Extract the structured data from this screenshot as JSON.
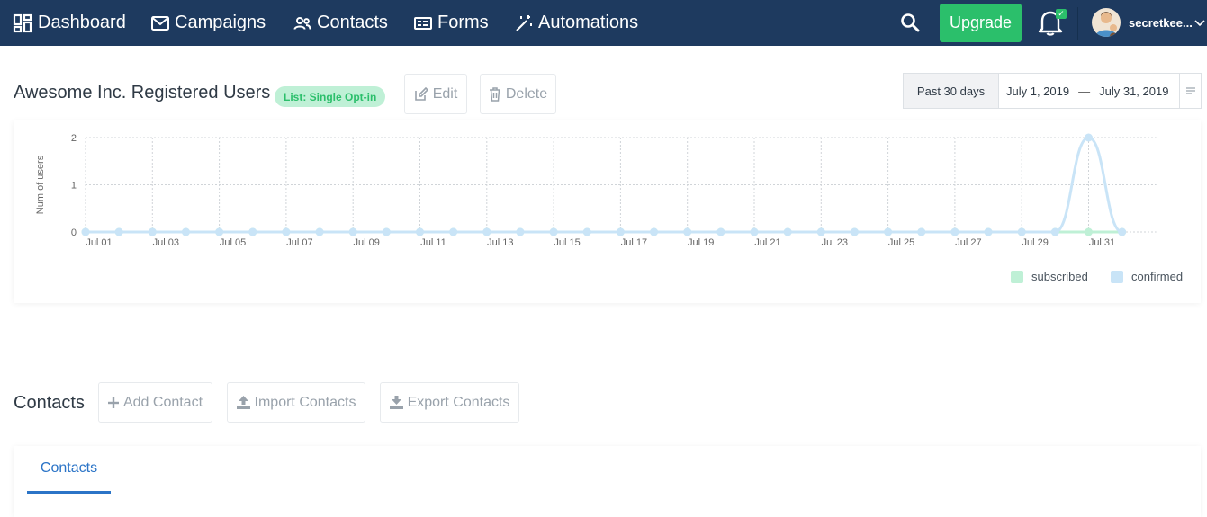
{
  "nav": {
    "items": [
      {
        "label": "Dashboard",
        "icon": "dashboard-icon"
      },
      {
        "label": "Campaigns",
        "icon": "envelope-icon"
      },
      {
        "label": "Contacts",
        "icon": "users-icon"
      },
      {
        "label": "Forms",
        "icon": "form-icon"
      },
      {
        "label": "Automations",
        "icon": "magic-wand-icon"
      }
    ],
    "upgrade_label": "Upgrade",
    "username": "secretkee...",
    "colors": {
      "bar": "#1e3a5f",
      "upgrade": "#2bbf6b"
    }
  },
  "list": {
    "title": "Awesome Inc. Registered Users",
    "badge": "List: Single Opt-in",
    "edit_label": "Edit",
    "delete_label": "Delete"
  },
  "date_range": {
    "preset": "Past 30 days",
    "start": "July 1, 2019",
    "dash": "—",
    "end": "July 31, 2019"
  },
  "chart_data": {
    "type": "area",
    "ylabel": "Num of users",
    "ylim": [
      0,
      2
    ],
    "y_ticks": [
      "0",
      "1",
      "2"
    ],
    "x": [
      "Jul 01",
      "Jul 02",
      "Jul 03",
      "Jul 04",
      "Jul 05",
      "Jul 06",
      "Jul 07",
      "Jul 08",
      "Jul 09",
      "Jul 10",
      "Jul 11",
      "Jul 12",
      "Jul 13",
      "Jul 14",
      "Jul 15",
      "Jul 16",
      "Jul 17",
      "Jul 18",
      "Jul 19",
      "Jul 20",
      "Jul 21",
      "Jul 22",
      "Jul 23",
      "Jul 24",
      "Jul 25",
      "Jul 26",
      "Jul 27",
      "Jul 28",
      "Jul 29",
      "Jul 30",
      "Jul 31",
      "Aug 01"
    ],
    "x_tick_labels": [
      "Jul 01",
      "Jul 03",
      "Jul 05",
      "Jul 07",
      "Jul 09",
      "Jul 11",
      "Jul 13",
      "Jul 15",
      "Jul 17",
      "Jul 19",
      "Jul 21",
      "Jul 23",
      "Jul 25",
      "Jul 27",
      "Jul 29",
      "Jul 31"
    ],
    "series": [
      {
        "name": "subscribed",
        "color": "#bff0d6",
        "values": [
          0,
          0,
          0,
          0,
          0,
          0,
          0,
          0,
          0,
          0,
          0,
          0,
          0,
          0,
          0,
          0,
          0,
          0,
          0,
          0,
          0,
          0,
          0,
          0,
          0,
          0,
          0,
          0,
          0,
          0,
          0,
          0
        ]
      },
      {
        "name": "confirmed",
        "color": "#c9e4f7",
        "values": [
          0,
          0,
          0,
          0,
          0,
          0,
          0,
          0,
          0,
          0,
          0,
          0,
          0,
          0,
          0,
          0,
          0,
          0,
          0,
          0,
          0,
          0,
          0,
          0,
          0,
          0,
          0,
          0,
          0,
          0,
          2,
          0
        ]
      }
    ],
    "grid": true,
    "legend_position": "bottom-right"
  },
  "contacts": {
    "title": "Contacts",
    "add_label": "Add Contact",
    "import_label": "Import Contacts",
    "export_label": "Export Contacts",
    "tab_label": "Contacts"
  }
}
